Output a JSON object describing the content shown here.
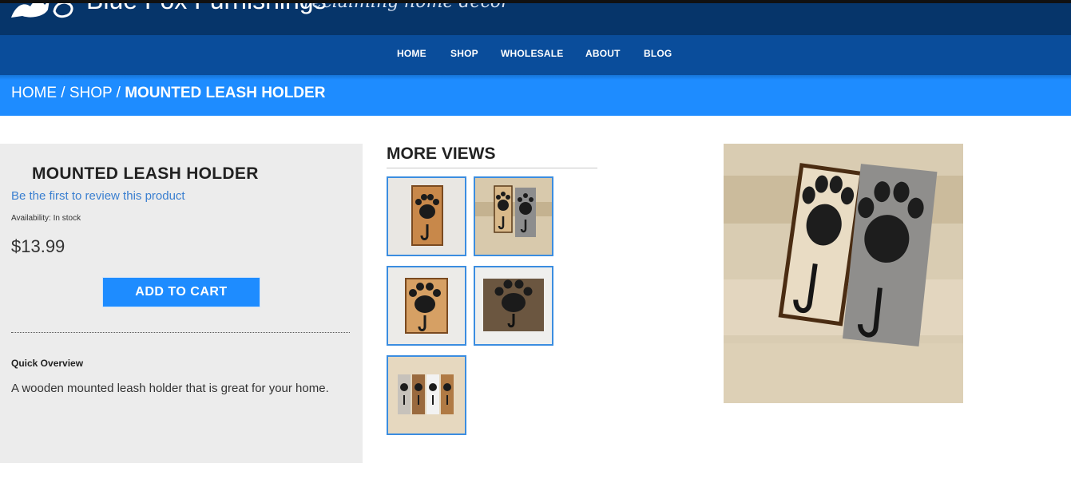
{
  "header": {
    "brand": "Blue Fox Furnishings",
    "tagline": "reclaiming home decor",
    "logo_icon": "fox-logo-icon",
    "colors": {
      "header": "#06356a",
      "nav": "#0a4d9b",
      "breadcrumb": "#1e8cff"
    }
  },
  "nav": {
    "items": [
      {
        "label": "HOME"
      },
      {
        "label": "SHOP"
      },
      {
        "label": "WHOLESALE"
      },
      {
        "label": "ABOUT"
      },
      {
        "label": "BLOG"
      }
    ]
  },
  "breadcrumb": {
    "home": "HOME",
    "shop": "SHOP",
    "current": "MOUNTED LEASH HOLDER",
    "separator": " / "
  },
  "product": {
    "name": "MOUNTED LEASH HOLDER",
    "review_link": "Be the first to review this product",
    "availability": "Availability: In stock",
    "price": "$13.99",
    "add_to_cart": "ADD TO CART",
    "quick_overview_title": "Quick Overview",
    "quick_overview_text": "A wooden mounted leash holder that is great for your home."
  },
  "more_views": {
    "title": "MORE VIEWS",
    "thumbnails": [
      {
        "alt": "paw leash holder natural wood"
      },
      {
        "alt": "two paw leash holders leaning"
      },
      {
        "alt": "paw leash holder light wood"
      },
      {
        "alt": "paw leash holder dark wood"
      },
      {
        "alt": "four paw leash holders set"
      }
    ]
  },
  "main_image": {
    "alt": "two paw print leash holders with hooks"
  }
}
